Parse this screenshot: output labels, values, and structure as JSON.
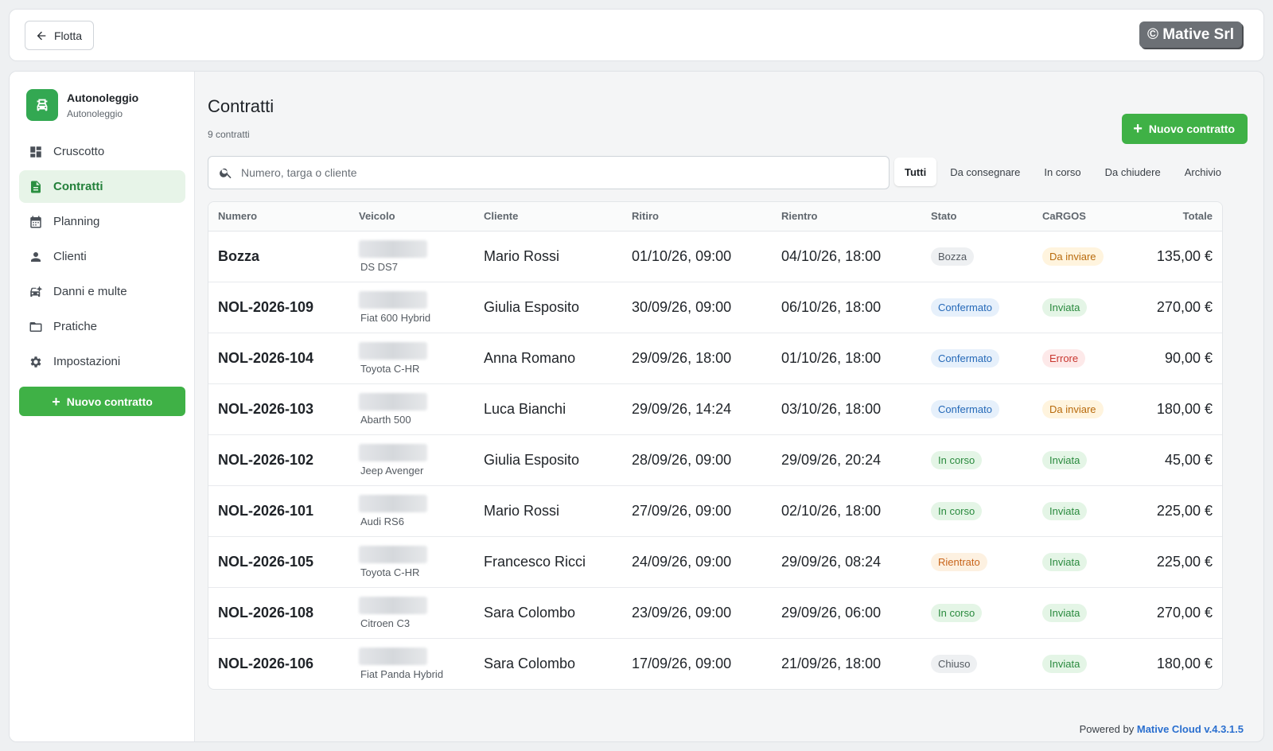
{
  "topbar": {
    "back_label": "Flotta",
    "copyright": "© Mative Srl"
  },
  "brand": {
    "title": "Autonoleggio",
    "subtitle": "Autonoleggio",
    "icon": "car-icon",
    "color": "#33a852"
  },
  "sidebar": {
    "items": [
      {
        "label": "Cruscotto",
        "icon": "dashboard-icon"
      },
      {
        "label": "Contratti",
        "icon": "document-icon",
        "active": true
      },
      {
        "label": "Planning",
        "icon": "calendar-icon"
      },
      {
        "label": "Clienti",
        "icon": "person-icon"
      },
      {
        "label": "Danni e multe",
        "icon": "car-damage-icon"
      },
      {
        "label": "Pratiche",
        "icon": "folder-icon"
      },
      {
        "label": "Impostazioni",
        "icon": "gear-icon"
      }
    ],
    "new_button": "Nuovo contratto"
  },
  "page": {
    "title": "Contratti",
    "count": "9 contratti",
    "new_button": "Nuovo contratto"
  },
  "search": {
    "placeholder": "Numero, targa o cliente"
  },
  "filters": [
    "Tutti",
    "Da consegnare",
    "In corso",
    "Da chiudere",
    "Archivio"
  ],
  "active_filter": "Tutti",
  "table": {
    "columns": [
      "Numero",
      "Veicolo",
      "Cliente",
      "Ritiro",
      "Rientro",
      "Stato",
      "CaRGOS",
      "Totale"
    ],
    "rows": [
      {
        "numero": "Bozza",
        "veicolo": "DS DS7",
        "cliente": "Mario Rossi",
        "ritiro": "01/10/26, 09:00",
        "rientro": "04/10/26, 18:00",
        "stato": "Bozza",
        "stato_kind": "grey",
        "cargos": "Da inviare",
        "cargos_kind": "amber",
        "totale": "135,00 €"
      },
      {
        "numero": "NOL-2026-109",
        "veicolo": "Fiat 600 Hybrid",
        "cliente": "Giulia Esposito",
        "ritiro": "30/09/26, 09:00",
        "rientro": "06/10/26, 18:00",
        "stato": "Confermato",
        "stato_kind": "blue",
        "cargos": "Inviata",
        "cargos_kind": "green",
        "totale": "270,00 €"
      },
      {
        "numero": "NOL-2026-104",
        "veicolo": "Toyota C-HR",
        "cliente": "Anna Romano",
        "ritiro": "29/09/26, 18:00",
        "rientro": "01/10/26, 18:00",
        "stato": "Confermato",
        "stato_kind": "blue",
        "cargos": "Errore",
        "cargos_kind": "red",
        "totale": "90,00 €"
      },
      {
        "numero": "NOL-2026-103",
        "veicolo": "Abarth 500",
        "cliente": "Luca Bianchi",
        "ritiro": "29/09/26, 14:24",
        "rientro": "03/10/26, 18:00",
        "stato": "Confermato",
        "stato_kind": "blue",
        "cargos": "Da inviare",
        "cargos_kind": "amber",
        "totale": "180,00 €"
      },
      {
        "numero": "NOL-2026-102",
        "veicolo": "Jeep Avenger",
        "cliente": "Giulia Esposito",
        "ritiro": "28/09/26, 09:00",
        "rientro": "29/09/26, 20:24",
        "stato": "In corso",
        "stato_kind": "green",
        "cargos": "Inviata",
        "cargos_kind": "green",
        "totale": "45,00 €"
      },
      {
        "numero": "NOL-2026-101",
        "veicolo": "Audi RS6",
        "cliente": "Mario Rossi",
        "ritiro": "27/09/26, 09:00",
        "rientro": "02/10/26, 18:00",
        "stato": "In corso",
        "stato_kind": "green",
        "cargos": "Inviata",
        "cargos_kind": "green",
        "totale": "225,00 €"
      },
      {
        "numero": "NOL-2026-105",
        "veicolo": "Toyota C-HR",
        "cliente": "Francesco Ricci",
        "ritiro": "24/09/26, 09:00",
        "rientro": "29/09/26, 08:24",
        "stato": "Rientrato",
        "stato_kind": "orange",
        "cargos": "Inviata",
        "cargos_kind": "green",
        "totale": "225,00 €"
      },
      {
        "numero": "NOL-2026-108",
        "veicolo": "Citroen C3",
        "cliente": "Sara Colombo",
        "ritiro": "23/09/26, 09:00",
        "rientro": "29/09/26, 06:00",
        "stato": "In corso",
        "stato_kind": "green",
        "cargos": "Inviata",
        "cargos_kind": "green",
        "totale": "270,00 €"
      },
      {
        "numero": "NOL-2026-106",
        "veicolo": "Fiat Panda Hybrid",
        "cliente": "Sara Colombo",
        "ritiro": "17/09/26, 09:00",
        "rientro": "21/09/26, 18:00",
        "stato": "Chiuso",
        "stato_kind": "grey",
        "cargos": "Inviata",
        "cargos_kind": "green",
        "totale": "180,00 €"
      }
    ]
  },
  "footer": {
    "prefix": "Powered by",
    "brand": "Mative Cloud v.4.3.1.5"
  },
  "colors": {
    "accent": "#3fb146",
    "link": "#2a6fcf"
  }
}
